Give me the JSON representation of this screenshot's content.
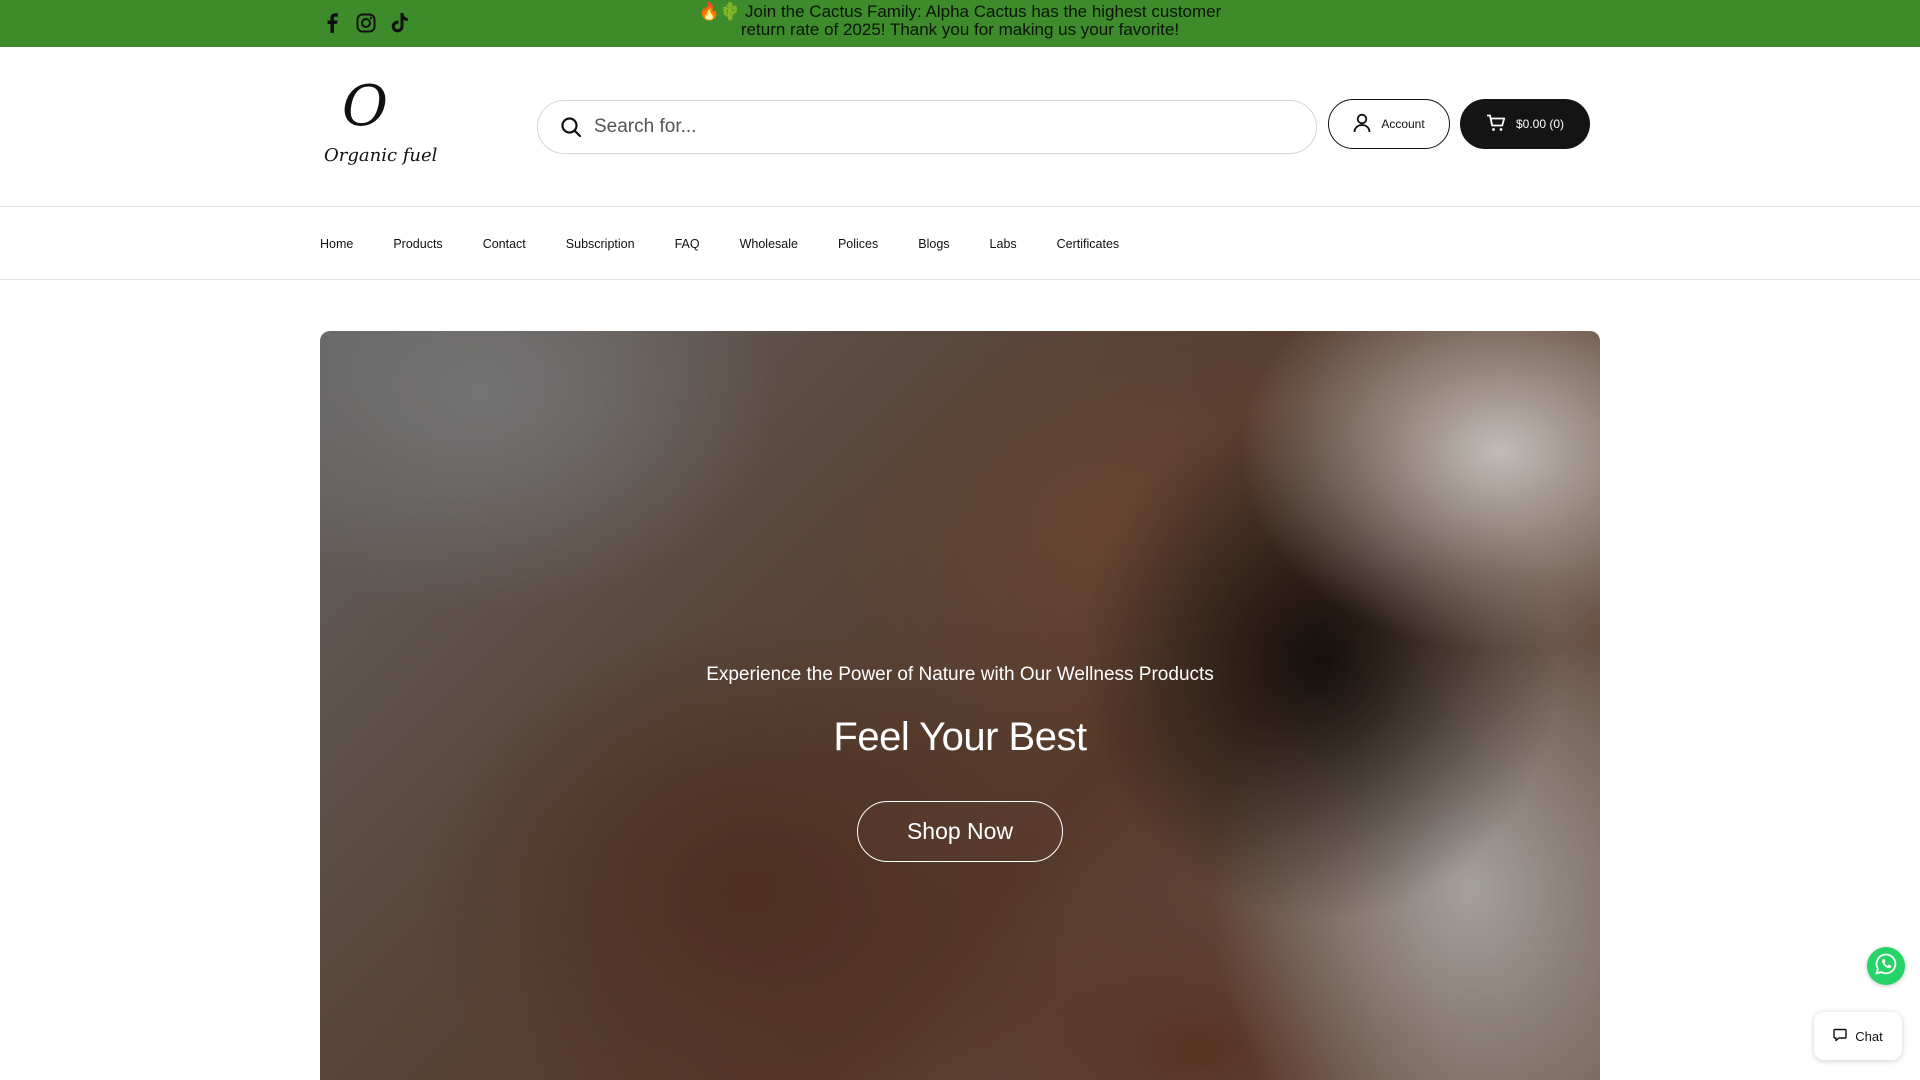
{
  "announcement": {
    "emoji": "🔥🌵",
    "text": "Join the Cactus Family: Alpha Cactus has the highest customer return rate of 2025! Thank you for making us your favorite!",
    "background": "#3d8b2a"
  },
  "social": [
    {
      "name": "facebook-icon"
    },
    {
      "name": "instagram-icon"
    },
    {
      "name": "tiktok-icon"
    }
  ],
  "logo": {
    "mark": "O",
    "wordmark": "Organic fuel"
  },
  "search": {
    "placeholder": "Search for..."
  },
  "header": {
    "account_label": "Account",
    "cart_label": "$0.00 (0)"
  },
  "nav": {
    "items": [
      "Home",
      "Products",
      "Contact",
      "Subscription",
      "FAQ",
      "Wholesale",
      "Polices",
      "Blogs",
      "Labs",
      "Certificates"
    ]
  },
  "hero": {
    "subtitle": "Experience the Power of Nature with Our Wellness Products",
    "title": "Feel Your Best",
    "cta_label": "Shop Now"
  },
  "widgets": {
    "chat_label": "Chat",
    "whatsapp_color": "#25d366"
  }
}
